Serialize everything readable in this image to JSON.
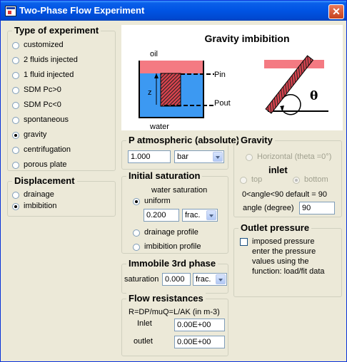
{
  "window": {
    "title": "Two-Phase Flow Experiment"
  },
  "experiment": {
    "title": "Type of experiment",
    "options": [
      "customized",
      "2 fluids injected",
      "1 fluid injected",
      "SDM Pc>0",
      "SDM Pc<0",
      "spontaneous",
      "gravity",
      "centrifugation",
      "porous plate"
    ],
    "selected": "gravity"
  },
  "displacement": {
    "title": "Displacement",
    "options": [
      "drainage",
      "imbibition"
    ],
    "selected": "imbibition"
  },
  "diagram": {
    "title": "Gravity imbibition",
    "oil_label": "oil",
    "water_label": "water",
    "z_label": "z",
    "pin_label": "Pin",
    "pout_label": "Pout",
    "theta_label": "θ",
    "colors": {
      "oil": "#f47a82",
      "water": "#3c99f2",
      "sample": "#d9434e"
    }
  },
  "patm": {
    "title": "P atmospheric (absolute)",
    "value": "1.000",
    "unit": "bar"
  },
  "gravity": {
    "title": "Gravity",
    "horizontal_label": "Horizontal (theta =0°)",
    "inlet_label": "inlet",
    "top_label": "top",
    "bottom_label": "bottom",
    "hint": "0<angle<90  default = 90",
    "angle_label": "angle (degree)",
    "angle_value": "90"
  },
  "saturation": {
    "title": "Initial saturation",
    "subtitle": "water saturation",
    "uniform_label": "uniform",
    "value": "0.200",
    "unit": "frac.",
    "drainage_label": "drainage profile",
    "imbibition_label": "imbibition profile"
  },
  "outlet": {
    "title": "Outlet pressure",
    "line1": "imposed pressure",
    "line2": "enter the pressure",
    "line3": "values using the",
    "line4": "function: load/fit data"
  },
  "immobile": {
    "title": "Immobile 3rd phase",
    "label": "saturation",
    "value": "0.000",
    "unit": "frac."
  },
  "resistance": {
    "title": "Flow resistances",
    "formula": "R=DP/muQ=L/AK  (in m-3)",
    "inlet_label": "Inlet",
    "inlet_value": "0.00E+00",
    "outlet_label": "outlet",
    "outlet_value": "0.00E+00"
  }
}
